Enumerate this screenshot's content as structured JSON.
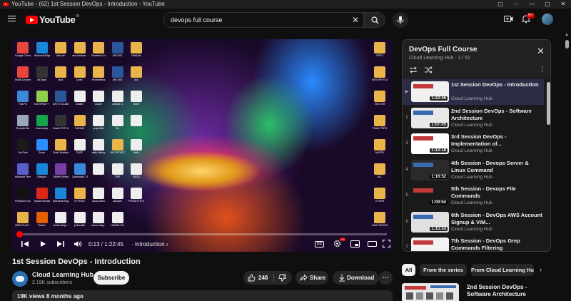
{
  "window": {
    "title": "YouTube - (62) 1st Session DevOps - Introduction - YouTube",
    "controls": [
      "▢",
      "⋯",
      "—",
      "▢",
      "✕"
    ]
  },
  "masthead": {
    "logo_text": "YouTube",
    "logo_region": "IN",
    "search_value": "devops full course",
    "notification_count": "9+"
  },
  "player": {
    "current_time": "0:13",
    "total_time": "1:22:45",
    "time_separator": " / ",
    "chapter": "Introduction",
    "progress": 0.003,
    "cc_label": "CC",
    "hd_label": "HD"
  },
  "desktop_icons": [
    {
      "label": "Google Chrome",
      "color": "#e8453c"
    },
    {
      "label": "Microsoft Edge",
      "color": "#1a86d8"
    },
    {
      "label": "k8s-adi",
      "color": "#e9b44a"
    },
    {
      "label": "aws-fundam..",
      "color": "#e9b44a"
    },
    {
      "label": "Terraform-Fo",
      "color": "#e9b44a"
    },
    {
      "label": "ARCHIO",
      "color": "#2b579a"
    },
    {
      "label": "K8s&Ats",
      "color": "#e9b44a"
    },
    {
      "label": "Shaik Chrome",
      "color": "#e8453c"
    },
    {
      "label": "Git Bash",
      "color": "#333333"
    },
    {
      "label": "java",
      "color": "#e9b44a"
    },
    {
      "label": "prom",
      "color": "#e9b44a"
    },
    {
      "label": "Prometheus",
      "color": "#e9b44a"
    },
    {
      "label": "ARCHIO",
      "color": "#2b579a"
    },
    {
      "label": "doc",
      "color": "#e9b44a"
    },
    {
      "label": "This PC",
      "color": "#3a88d8"
    },
    {
      "label": "NOTEPAD++",
      "color": "#8fd14f"
    },
    {
      "label": "DKT SYLLABUS",
      "color": "#2b579a"
    },
    {
      "label": "ansible",
      "color": "#eeeeee"
    },
    {
      "label": "docker",
      "color": "#eeeeee"
    },
    {
      "label": "ansible ci",
      "color": "#eeeeee"
    },
    {
      "label": "sheet",
      "color": "#eeeeee"
    },
    {
      "label": "Recycle Bin",
      "color": "#9aa8b8"
    },
    {
      "label": "Grammarly",
      "color": "#16a34a"
    },
    {
      "label": "Snake PDF Desktop 14",
      "color": "#333333"
    },
    {
      "label": "RAHAM",
      "color": "#e9b44a"
    },
    {
      "label": "projectfile",
      "color": "#eeeeee"
    },
    {
      "label": "file",
      "color": "#eeeeee"
    },
    {
      "label": "",
      "color": "#eeeeee"
    },
    {
      "label": "YouTube",
      "color": "#1a1a1a"
    },
    {
      "label": "Zoom",
      "color": "#2d8cff"
    },
    {
      "label": "Shaik Mustafa",
      "color": "#e9b44a"
    },
    {
      "label": "DATE",
      "color": "#eeeeee"
    },
    {
      "label": "daily history",
      "color": "#eeeeee"
    },
    {
      "label": "K8S PROJECT",
      "color": "#e9b44a"
    },
    {
      "label": "daily",
      "color": "#eeeeee"
    },
    {
      "label": "Microsoft Teams (wo...",
      "color": "#5b5fc7"
    },
    {
      "label": "Octopus",
      "color": "#1a86d8"
    },
    {
      "label": "GitHub Desktop",
      "color": "#7a3ea8"
    },
    {
      "label": "Downloads - Shortcut",
      "color": "#3a88d8"
    },
    {
      "label": "",
      "color": "#eeeeee"
    },
    {
      "label": "TIPS",
      "color": "#eeeeee"
    },
    {
      "label": "ABCD",
      "color": "#eeeeee"
    },
    {
      "label": "PhpStorm Convert...",
      "color": "#111111"
    },
    {
      "label": "Adobe Acrobat",
      "color": "#d9281a"
    },
    {
      "label": "Microsoft Edge",
      "color": "#1a86d8"
    },
    {
      "label": "KYYRUS",
      "color": "#e9b44a"
    },
    {
      "label": "ansa codes",
      "color": "#eeeeee"
    },
    {
      "label": "allocate",
      "color": "#eeeeee"
    },
    {
      "label": "PROJETTE-KORAINNA...",
      "color": "#eeeeee"
    },
    {
      "label": "NEW CLAS...",
      "color": "#e9b44a"
    },
    {
      "label": "Firefox",
      "color": "#e66000"
    },
    {
      "label": "docker-depl...",
      "color": "#eeeeee"
    },
    {
      "label": "jenkinsfile",
      "color": "#eeeeee"
    },
    {
      "label": "nexus integ...",
      "color": "#eeeeee"
    },
    {
      "label": "HANDS ON",
      "color": "#eeeeee"
    }
  ],
  "desktop_right_icons": [
    {
      "label": "PDFS"
    },
    {
      "label": "DEVOPS FILES"
    },
    {
      "label": "VECTOR"
    },
    {
      "label": "FINAL PDFS"
    },
    {
      "label": "MUSTA"
    },
    {
      "label": "ALL"
    },
    {
      "label": "OTHER"
    },
    {
      "label": "AWS VIDEOS"
    }
  ],
  "video": {
    "title": "1st Session DevOps - Introduction",
    "channel": "Cloud Learning Hub",
    "subscribers": "2.19K subscribers",
    "subscribe_label": "Subscribe",
    "likes": "248",
    "share_label": "Share",
    "download_label": "Download",
    "more_label": "···",
    "views_meta": "19K views  8 months ago"
  },
  "playlist": {
    "title": "DevOps Full Course",
    "subtitle": "Cloud Learning Hub - 1 / 51",
    "items": [
      {
        "index": "▶",
        "title": "1st Session DevOps - Introduction",
        "channel": "Cloud Learning Hub",
        "duration": "1:22:46",
        "active": true
      },
      {
        "index": "2",
        "title": "2nd Session DevOps - Software Architecture",
        "channel": "Cloud Learning Hub",
        "duration": "1:07:05",
        "active": false
      },
      {
        "index": "3",
        "title": "3rd Session DevOps - Implementation of...",
        "channel": "Cloud Learning Hub",
        "duration": "1:12:18",
        "active": false
      },
      {
        "index": "4",
        "title": "4th Session - Devops Server & Linux Command",
        "channel": "Cloud Learning Hub",
        "duration": "1:16:52",
        "active": false
      },
      {
        "index": "5",
        "title": "5th Session - Devops File Commands",
        "channel": "Cloud Learning Hub",
        "duration": "1:09:54",
        "active": false
      },
      {
        "index": "6",
        "title": "6th Session - DevOps AWS Account Signup & VIM...",
        "channel": "Cloud Learning Hub",
        "duration": "1:15:33",
        "active": false
      },
      {
        "index": "7",
        "title": "7th Session - DevOps Grep Commands Filtering",
        "channel": "Cloud Learning Hub",
        "duration": "1:27:27",
        "active": false
      }
    ]
  },
  "chips": [
    {
      "label": "All",
      "active": true
    },
    {
      "label": "From the series",
      "active": false
    },
    {
      "label": "From Cloud Learning Hub",
      "active": false
    }
  ],
  "recommendation": {
    "title": "2nd Session DevOps - Software Architecture"
  },
  "colors": {
    "background": "#0f0f0f",
    "accent_red": "#ff0000",
    "active_playlist_item": "#2c2c46"
  }
}
